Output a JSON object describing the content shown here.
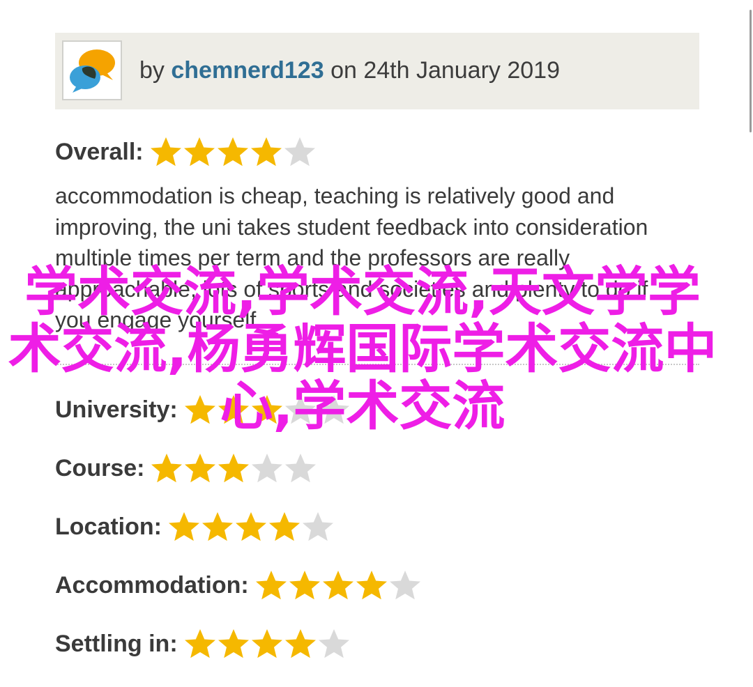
{
  "review": {
    "by_prefix": "by",
    "author": "chemnerd123",
    "date_text": "on 24th January 2019",
    "avatar_icon": "speech-bubbles-icon",
    "overall": {
      "label": "Overall:",
      "rating": 4,
      "max": 5
    },
    "comment": "accommodation is cheap, teaching is relatively good and improving, the uni takes student feedback into consideration multiple times per term and the professors are really approachable, lots of sports and societies and plenty to do if you engage yourself",
    "ratings": [
      {
        "label": "University:",
        "rating": 3,
        "max": 5
      },
      {
        "label": "Course:",
        "rating": 3,
        "max": 5
      },
      {
        "label": "Location:",
        "rating": 4,
        "max": 5
      },
      {
        "label": "Accommodation:",
        "rating": 4,
        "max": 5
      },
      {
        "label": "Settling in:",
        "rating": 4,
        "max": 5
      }
    ]
  },
  "watermark": {
    "text": "学术交流,学术交流,天文学学术交流,杨勇辉国际学术交流中心,学术交流",
    "color": "#ee1ee6"
  },
  "colors": {
    "star_filled": "#f5b800",
    "star_empty": "#d9d9d9",
    "header_bg": "#eeede7",
    "author_link": "#2f6e94"
  }
}
